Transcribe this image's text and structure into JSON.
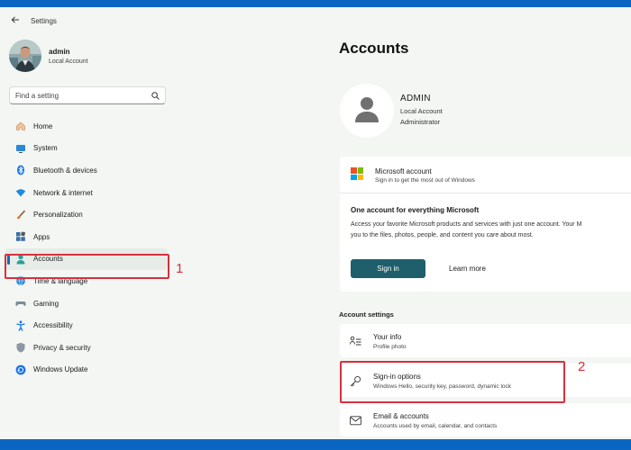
{
  "app": {
    "title": "Settings"
  },
  "profile": {
    "name": "admin",
    "type": "Local Account"
  },
  "search": {
    "placeholder": "Find a setting"
  },
  "nav": [
    {
      "label": "Home",
      "icon": "home-icon"
    },
    {
      "label": "System",
      "icon": "display-icon"
    },
    {
      "label": "Bluetooth & devices",
      "icon": "bluetooth-icon"
    },
    {
      "label": "Network & internet",
      "icon": "wifi-icon"
    },
    {
      "label": "Personalization",
      "icon": "brush-icon"
    },
    {
      "label": "Apps",
      "icon": "apps-icon"
    },
    {
      "label": "Accounts",
      "icon": "person-icon",
      "selected": true
    },
    {
      "label": "Time & language",
      "icon": "clock-globe-icon"
    },
    {
      "label": "Gaming",
      "icon": "gamepad-icon"
    },
    {
      "label": "Accessibility",
      "icon": "accessibility-icon"
    },
    {
      "label": "Privacy & security",
      "icon": "shield-icon"
    },
    {
      "label": "Windows Update",
      "icon": "update-icon"
    }
  ],
  "annotations": {
    "step1": "1",
    "step2": "2",
    "color": "#d9303e"
  },
  "page": {
    "title": "Accounts",
    "account": {
      "name": "ADMIN",
      "type": "Local Account",
      "role": "Administrator"
    }
  },
  "microsoft_card": {
    "title": "Microsoft account",
    "subtitle": "Sign in to get the most out of Windows",
    "heading": "One account for everything Microsoft",
    "body_line1": "Access your favorite Microsoft products and services with just one account. Your M",
    "body_line2": "you to the files, photos, people, and content you care about most.",
    "signin_label": "Sign in",
    "learn_more_label": "Learn more"
  },
  "account_settings": {
    "label": "Account settings",
    "items": [
      {
        "title": "Your info",
        "subtitle": "Profile photo",
        "icon": "person-list-icon"
      },
      {
        "title": "Sign-in options",
        "subtitle": "Windows Hello, security key, password, dynamic lock",
        "icon": "key-icon"
      },
      {
        "title": "Email & accounts",
        "subtitle": "Accounts used by email, calendar, and contacts",
        "icon": "mail-icon"
      }
    ]
  },
  "colors": {
    "accent": "#0f6cbd",
    "frame": "#0a66c2",
    "button": "#1f5f6b",
    "window_bg": "#f3f6f3"
  }
}
